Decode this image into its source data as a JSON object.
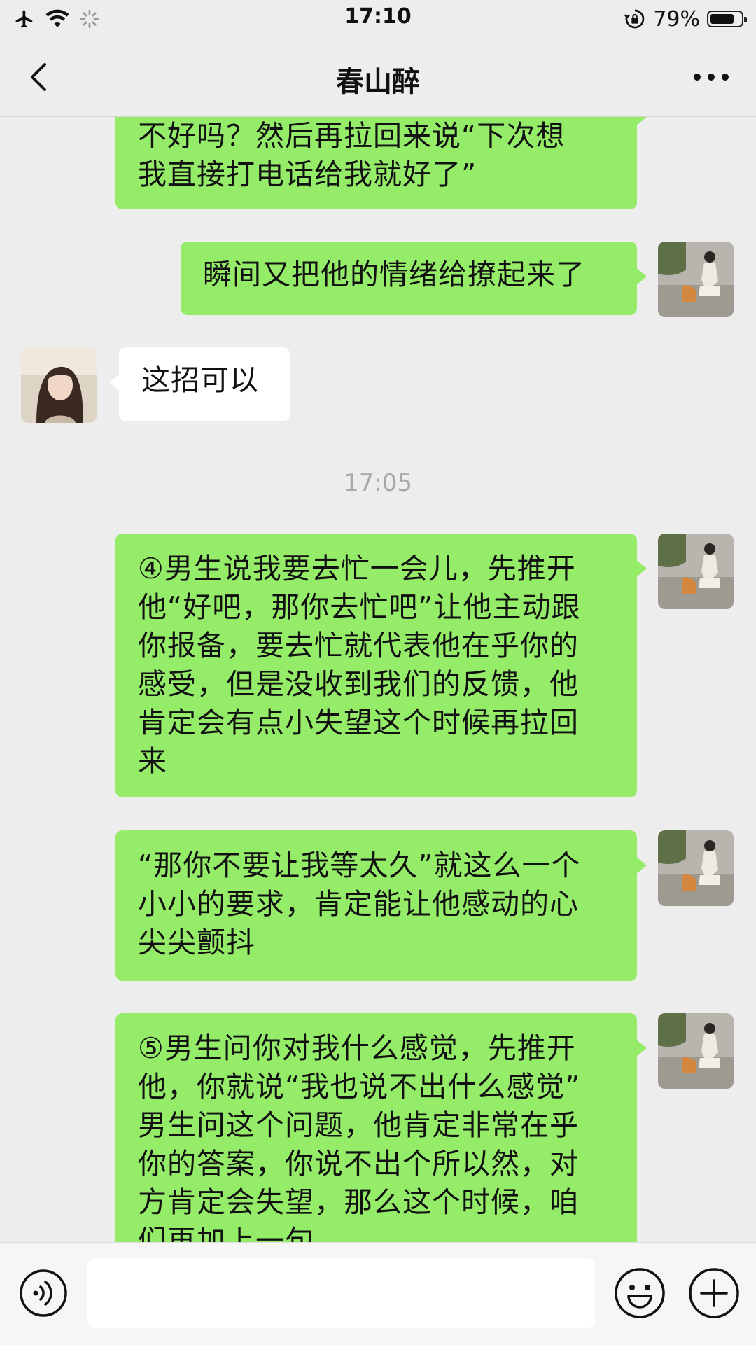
{
  "status_bar": {
    "time": "17:10",
    "battery_percent": "79%",
    "battery_level": 0.79
  },
  "nav": {
    "title": "春山醉"
  },
  "messages": [
    {
      "side": "sent",
      "text": "不好吗？然后再拉回来说“下次想\n我直接打电话给我就好了”"
    },
    {
      "side": "sent",
      "text": "瞬间又把他的情绪给撩起来了"
    },
    {
      "side": "received",
      "text": "这招可以"
    },
    {
      "timestamp": "17:05"
    },
    {
      "side": "sent",
      "text": "④男生说我要去忙一会儿，先推开\n他“好吧，那你去忙吧”让他主动跟\n你报备，要去忙就代表他在乎你的\n感受，但是没收到我们的反馈，他\n肯定会有点小失望这个时候再拉回\n来"
    },
    {
      "side": "sent",
      "text": "“那你不要让我等太久”就这么一个\n小小的要求，肯定能让他感动的心\n尖尖颤抖"
    },
    {
      "side": "sent",
      "text": "⑤男生问你对我什么感觉，先推开\n他，你就说“我也说不出什么感觉”\n男生问这个问题，他肯定非常在乎\n你的答案，你说不出个所以然，对\n方肯定会失望，那么这个时候，咱\n们再加上一句"
    }
  ],
  "input_bar": {
    "field_value": ""
  },
  "colors": {
    "sent_bubble": "#95ec69",
    "received_bubble": "#ffffff",
    "background": "#ededed"
  }
}
